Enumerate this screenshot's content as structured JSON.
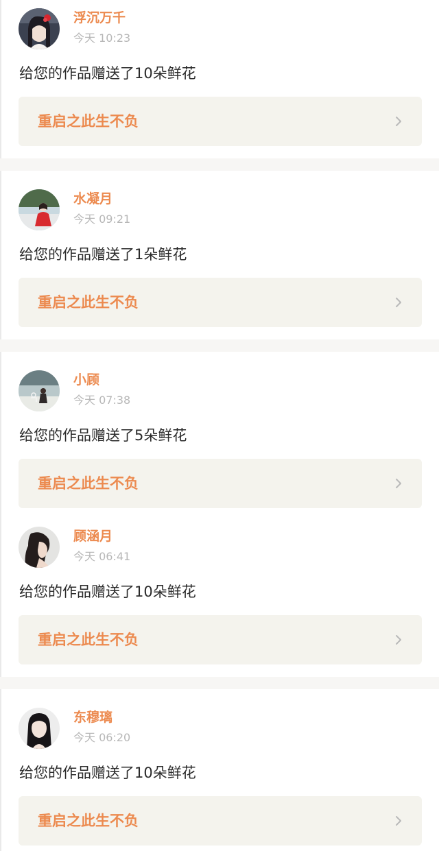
{
  "notifications": [
    {
      "username": "浮沉万千",
      "time": "今天 10:23",
      "message": "给您的作品赠送了10朵鲜花",
      "work_title": "重启之此生不负",
      "avatar_icon": "avatar-girl-red-flower"
    },
    {
      "username": "水凝月",
      "time": "今天 09:21",
      "message": "给您的作品赠送了1朵鲜花",
      "work_title": "重启之此生不负",
      "avatar_icon": "avatar-girl-red-dress-lake"
    },
    {
      "username": "小顾",
      "time": "今天 07:38",
      "message": "给您的作品赠送了5朵鲜花",
      "work_title": "重启之此生不负",
      "avatar_icon": "avatar-seaside-scene"
    },
    {
      "username": "顾涵月",
      "time": "今天 06:41",
      "message": "给您的作品赠送了10朵鲜花",
      "work_title": "重启之此生不负",
      "avatar_icon": "avatar-girl-profile"
    },
    {
      "username": "东穆璃",
      "time": "今天 06:20",
      "message": "给您的作品赠送了10朵鲜花",
      "work_title": "重启之此生不负",
      "avatar_icon": "avatar-girl-dark-hair"
    }
  ],
  "colors": {
    "accent": "#ec8a4f",
    "card_background": "#f4f3ed",
    "timestamp": "#b7b7b7",
    "message_text": "#2a2a2a",
    "divider": "#f7f6f4"
  }
}
